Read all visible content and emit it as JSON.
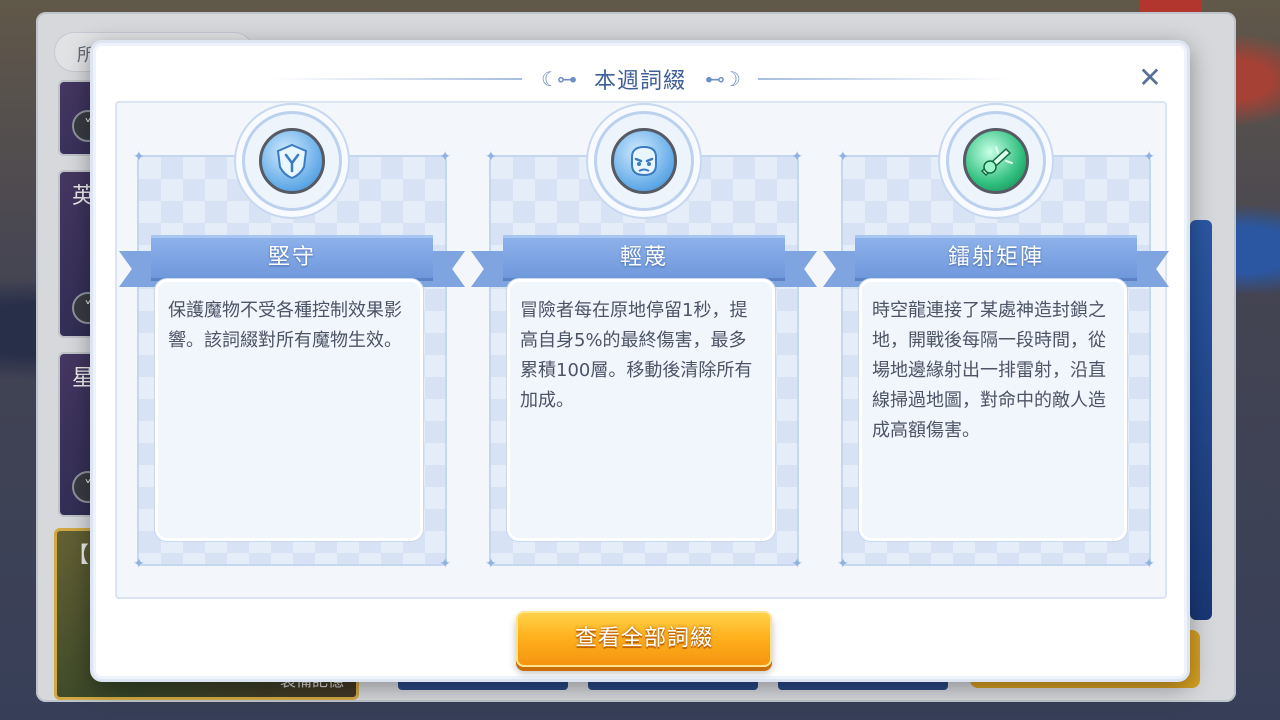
{
  "background": {
    "filter_label": "所",
    "cards": [
      {
        "title": "英"
      },
      {
        "title": "星"
      }
    ],
    "bottom_card": {
      "title": "【 凜",
      "subtitle": "裝備記憶"
    }
  },
  "modal": {
    "title": "本週詞綴",
    "title_left_deco": "☾⊶",
    "title_right_deco": "⊷☽",
    "close_icon": "✕",
    "cards": [
      {
        "name": "堅守",
        "icon": "shield-icon",
        "description": "保護魔物不受各種控制效果影響。該詞綴對所有魔物生效。"
      },
      {
        "name": "輕蔑",
        "icon": "angry-face-icon",
        "description": "冒險者每在原地停留1秒，提高自身5%的最終傷害，最多累積100層。移動後清除所有加成。"
      },
      {
        "name": "鐳射矩陣",
        "icon": "laser-icon",
        "description": "時空龍連接了某處神造封鎖之地，開戰後每隔一段時間，從場地邊緣射出一排雷射，沿直線掃過地圖，對命中的敵人造成高額傷害。"
      }
    ],
    "view_all_button": "查看全部詞綴"
  },
  "colors": {
    "title": "#3f5f98",
    "ribbon": "#7fa4df",
    "button": "#ffb21e"
  }
}
